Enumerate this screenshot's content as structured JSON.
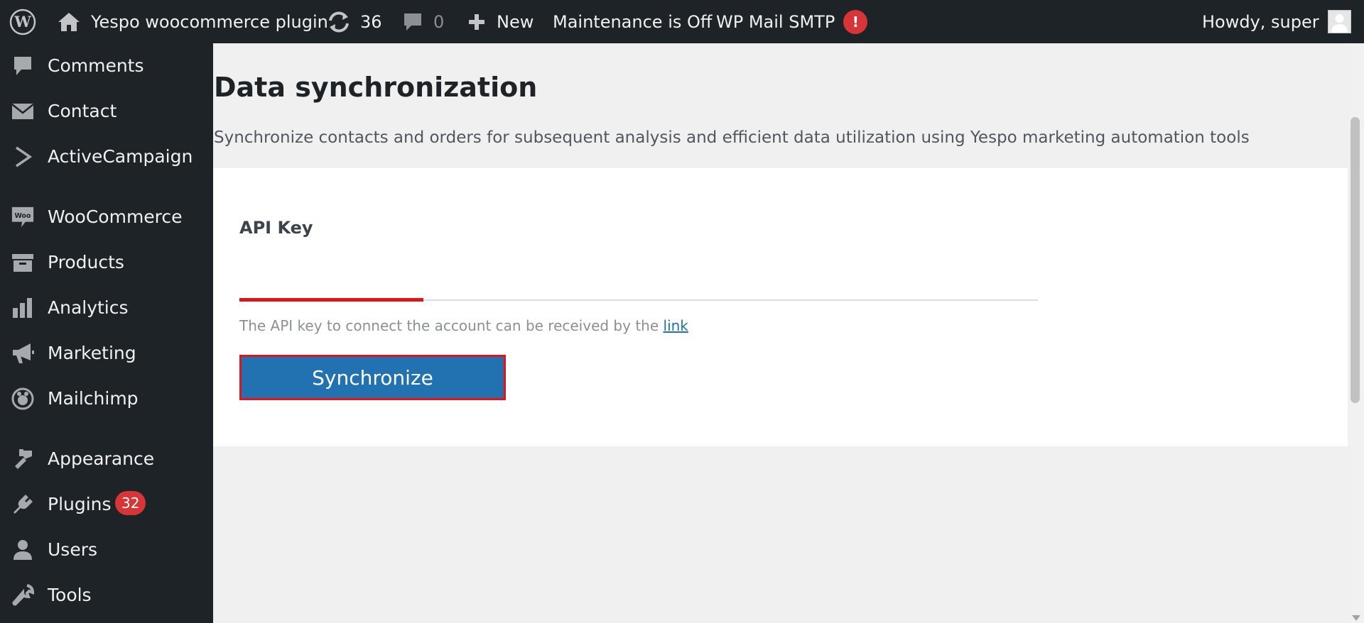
{
  "adminbar": {
    "site_name": "Yespo woocommerce plugin",
    "updates_count": "36",
    "comments_count": "0",
    "new_label": "New",
    "maintenance_label": "Maintenance is Off",
    "smtp_label": "WP Mail SMTP",
    "smtp_alert": "!",
    "howdy": "Howdy, super"
  },
  "sidebar": {
    "items": [
      {
        "label": "Comments",
        "icon": "comment-icon"
      },
      {
        "label": "Contact",
        "icon": "envelope-icon"
      },
      {
        "label": "ActiveCampaign",
        "icon": "chevron-right-icon"
      },
      {
        "label": "WooCommerce",
        "icon": "woocommerce-icon"
      },
      {
        "label": "Products",
        "icon": "archive-icon"
      },
      {
        "label": "Analytics",
        "icon": "bar-chart-icon"
      },
      {
        "label": "Marketing",
        "icon": "megaphone-icon"
      },
      {
        "label": "Mailchimp",
        "icon": "mailchimp-icon"
      },
      {
        "label": "Appearance",
        "icon": "paintbrush-icon"
      },
      {
        "label": "Plugins",
        "icon": "plugin-icon"
      },
      {
        "label": "Users",
        "icon": "user-icon"
      },
      {
        "label": "Tools",
        "icon": "wrench-icon"
      }
    ],
    "plugins_badge": "32"
  },
  "main": {
    "title": "Data synchronization",
    "description": "Synchronize contacts and orders for subsequent analysis and efficient data utilization using Yespo marketing automation tools",
    "api_key_label": "API Key",
    "api_key_value": "",
    "api_key_placeholder": "",
    "hint_text": "The API key to connect the account can be received by the ",
    "hint_link": "link",
    "sync_button": "Synchronize"
  },
  "colors": {
    "adminbar_bg": "#1d2327",
    "primary_button": "#2271b1",
    "accent_red": "#e2141b",
    "badge_red": "#d63638"
  }
}
